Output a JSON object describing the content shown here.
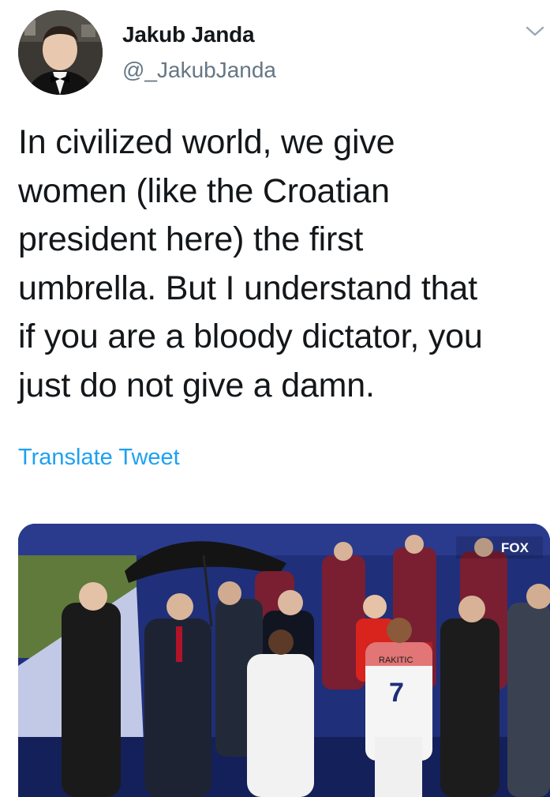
{
  "author": {
    "name": "Jakub Janda",
    "handle": "@_JakubJanda"
  },
  "tweet": {
    "text": "In civilized world, we give\nwomen (like the Croatian\npresident here) the first\numbrella. But I understand that\nif you are a bloody dictator, you\njust do not give a damn."
  },
  "actions": {
    "translate_label": "Translate Tweet"
  },
  "media": {
    "broadcaster_logo": "FOX",
    "jersey_name": "RAKITIC",
    "jersey_number": "7"
  },
  "icons": {
    "more": "chevron-down-icon"
  },
  "colors": {
    "link": "#1da1f2",
    "handle": "#657786",
    "text": "#14171a"
  }
}
